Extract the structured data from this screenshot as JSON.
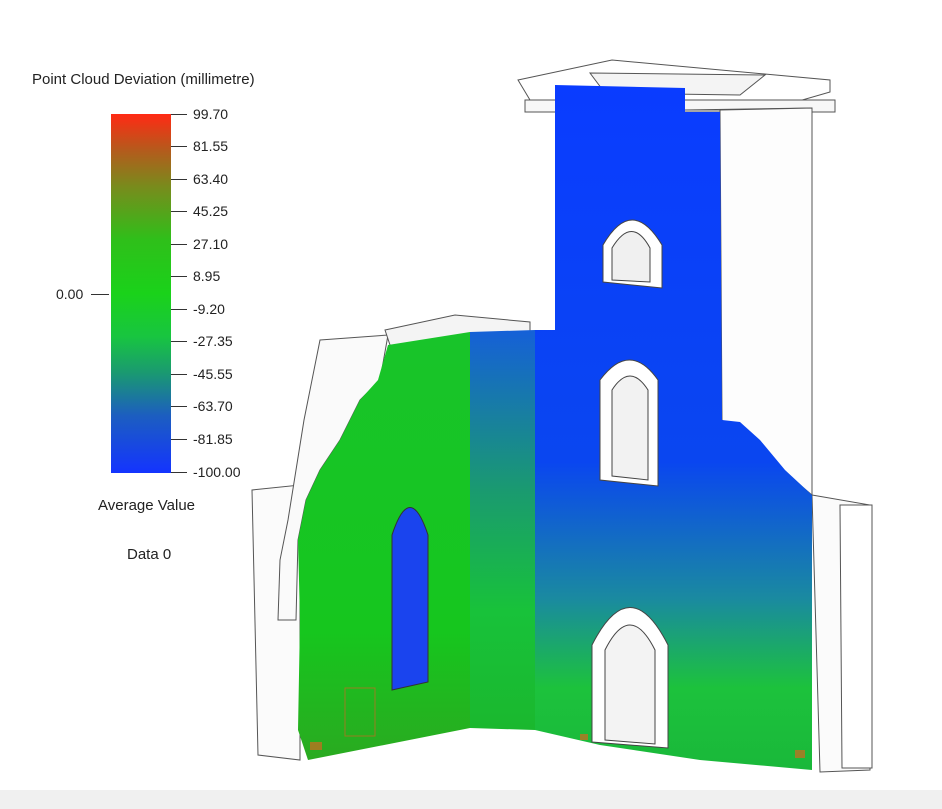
{
  "legend": {
    "title": "Point Cloud Deviation (millimetre)",
    "ticks": [
      "99.70",
      "81.55",
      "63.40",
      "45.25",
      "27.10",
      "8.95",
      "-9.20",
      "-27.35",
      "-45.55",
      "-63.70",
      "-81.85",
      "-100.00"
    ],
    "zero_label": "0.00",
    "average_label": "Average Value",
    "data_label": "Data 0",
    "colors": {
      "high": "#ff2a14",
      "mid": "#1ad21a",
      "low": "#1434ff"
    }
  }
}
